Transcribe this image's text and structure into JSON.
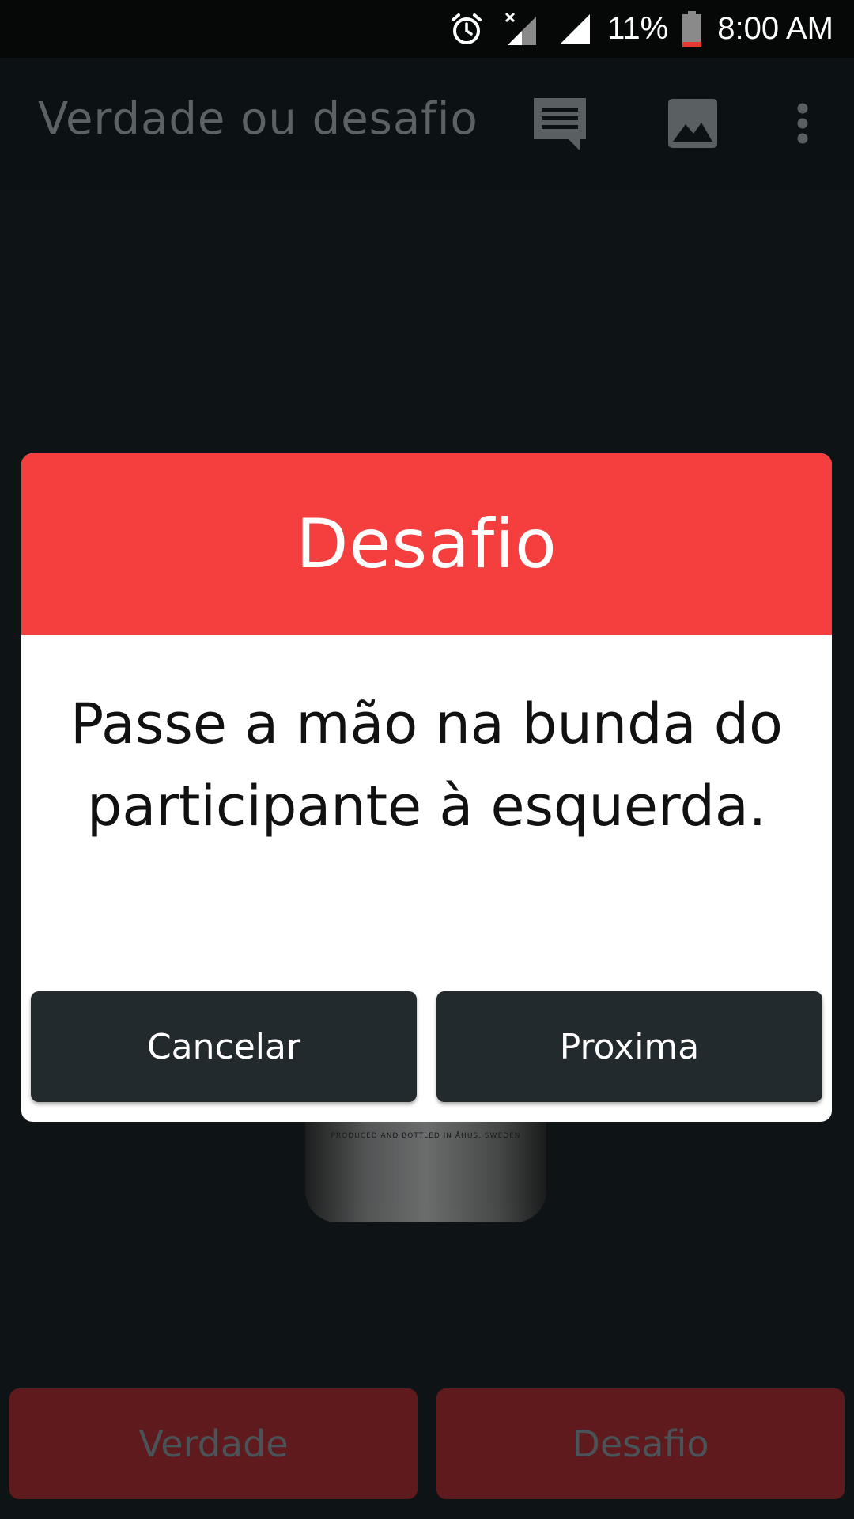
{
  "status_bar": {
    "battery": "11%",
    "time": "8:00 AM",
    "icons": [
      "alarm-icon",
      "no-data-signal-icon",
      "cell-signal-icon",
      "battery-low-icon"
    ],
    "battery_color": "#e53935"
  },
  "app_bar": {
    "title": "Verdade ou desafio",
    "actions": [
      "chat-icon",
      "image-icon",
      "more-vert-icon"
    ]
  },
  "background": {
    "bottle_label": "PRODUCED AND BOTTLED IN ÅHUS, SWEDEN",
    "buttons": {
      "verdade": "Verdade",
      "desafio": "Desafio"
    }
  },
  "dialog": {
    "title": "Desafio",
    "message": "Passe a mão na bunda do participante à esquerda.",
    "cancel_label": "Cancelar",
    "next_label": "Proxima",
    "header_color": "#f53e3e"
  },
  "colors": {
    "accent_red": "#f53e3e",
    "dark_button": "#222a2e",
    "dimmed_red_button": "#5e1a1c"
  }
}
